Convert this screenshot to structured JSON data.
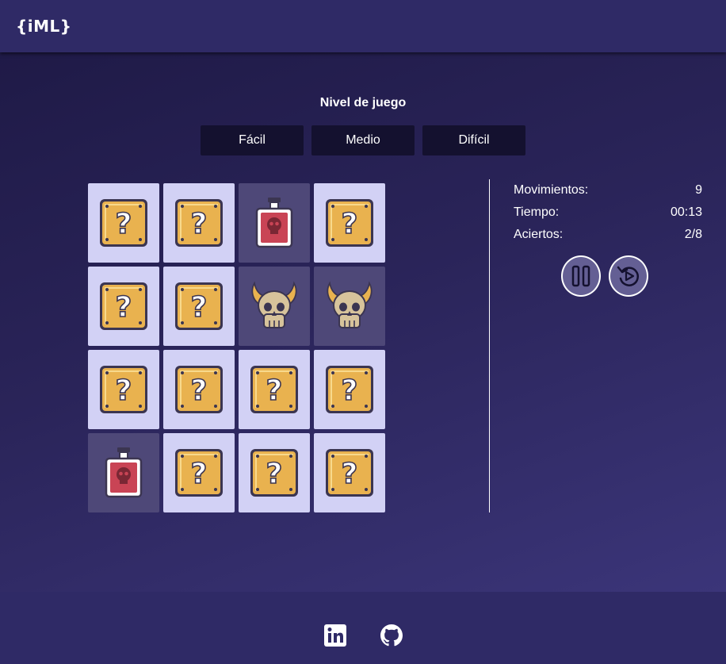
{
  "header": {
    "logo": "{iML}"
  },
  "game": {
    "level_title": "Nivel de juego",
    "levels": [
      "Fácil",
      "Medio",
      "Difícil"
    ],
    "board": [
      [
        "question-block-icon",
        "question-block-icon",
        "poison-bottle-icon",
        "question-block-icon"
      ],
      [
        "question-block-icon",
        "question-block-icon",
        "horned-skull-icon",
        "horned-skull-icon"
      ],
      [
        "question-block-icon",
        "question-block-icon",
        "question-block-icon",
        "question-block-icon"
      ],
      [
        "poison-bottle-icon",
        "question-block-icon",
        "question-block-icon",
        "question-block-icon"
      ]
    ]
  },
  "stats": {
    "moves_label": "Movimientos:",
    "moves_value": "9",
    "time_label": "Tiempo:",
    "time_value": "00:13",
    "hits_label": "Aciertos:",
    "hits_value": "2/8"
  },
  "controls": {
    "pause_icon": "pause-icon",
    "restart_icon": "restart-icon"
  },
  "footer": {
    "icons": [
      "linkedin-icon",
      "github-icon"
    ]
  },
  "colors": {
    "header_bg": "#2f2a66",
    "card_hidden": "#d2d1f5",
    "card_revealed": "#4e4878",
    "level_button": "#14112f",
    "question_block": "#e9b24f",
    "potion": "#c94455",
    "skull": "#d7c39b"
  }
}
